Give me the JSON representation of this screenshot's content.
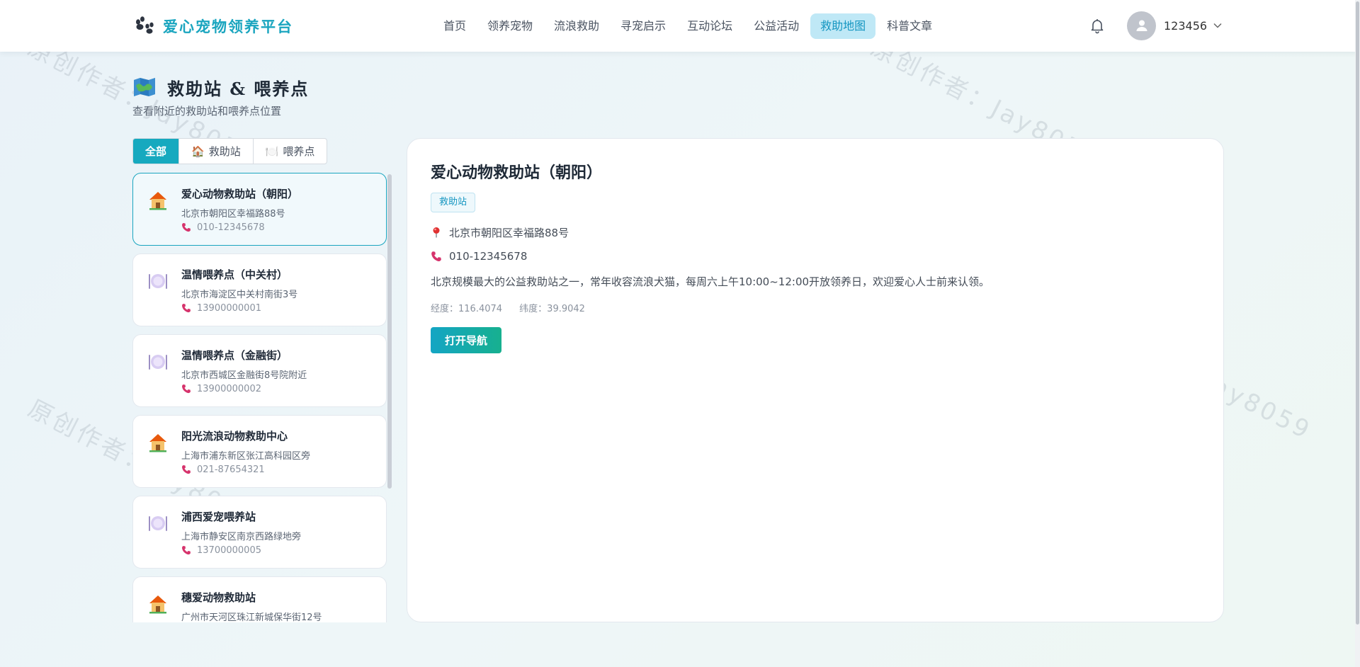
{
  "header": {
    "brand": "爱心宠物领养平台",
    "nav": [
      {
        "label": "首页",
        "active": false
      },
      {
        "label": "领养宠物",
        "active": false
      },
      {
        "label": "流浪救助",
        "active": false
      },
      {
        "label": "寻宠启示",
        "active": false
      },
      {
        "label": "互动论坛",
        "active": false
      },
      {
        "label": "公益活动",
        "active": false
      },
      {
        "label": "救助地图",
        "active": true
      },
      {
        "label": "科普文章",
        "active": false
      }
    ],
    "username": "123456"
  },
  "page": {
    "title": "救助站 & 喂养点",
    "subtitle": "查看附近的救助站和喂养点位置"
  },
  "filters": [
    {
      "label": "全部",
      "icon": "",
      "active": true
    },
    {
      "label": "救助站",
      "icon": "🏠",
      "active": false
    },
    {
      "label": "喂养点",
      "icon": "🍽️",
      "active": false
    }
  ],
  "stations": [
    {
      "name": "爱心动物救助站（朝阳）",
      "address": "北京市朝阳区幸福路88号",
      "phone": "010-12345678",
      "type": "station"
    },
    {
      "name": "温情喂养点（中关村）",
      "address": "北京市海淀区中关村南街3号",
      "phone": "13900000001",
      "type": "feeding"
    },
    {
      "name": "温情喂养点（金融街）",
      "address": "北京市西城区金融街8号院附近",
      "phone": "13900000002",
      "type": "feeding"
    },
    {
      "name": "阳光流浪动物救助中心",
      "address": "上海市浦东新区张江高科园区旁",
      "phone": "021-87654321",
      "type": "station"
    },
    {
      "name": "浦西爱宠喂养站",
      "address": "上海市静安区南京西路绿地旁",
      "phone": "13700000005",
      "type": "feeding"
    },
    {
      "name": "穗爱动物救助站",
      "address": "广州市天河区珠江新城保华街12号",
      "phone": "",
      "type": "station"
    }
  ],
  "selected_index": 0,
  "detail": {
    "name": "爱心动物救助站（朝阳）",
    "tag": "救助站",
    "address": "北京市朝阳区幸福路88号",
    "phone": "010-12345678",
    "description": "北京规模最大的公益救助站之一，常年收容流浪犬猫，每周六上午10:00~12:00开放领养日，欢迎爱心人士前来认领。",
    "longitude_label": "经度：116.4074",
    "latitude_label": "纬度：39.9042",
    "nav_button": "打开导航"
  },
  "watermark": "原创作者：Jay8059",
  "icons": {
    "brand": "paw-icon",
    "bell": "bell-icon",
    "avatar": "user-icon",
    "dropdown": "chevron-down-icon",
    "title": "map-icon",
    "station": "house-icon",
    "feeding": "plate-icon",
    "phone": "phone-icon",
    "address": "pin-icon"
  },
  "colors": {
    "primary": "#1aa5bf",
    "nav_active_bg": "#bfe8f6",
    "nav_active_text": "#1596c1",
    "phone_icon": "#d6336c",
    "pin_icon": "#e03131",
    "button_gradient_start": "#14a5c4",
    "button_gradient_end": "#17b08f"
  }
}
